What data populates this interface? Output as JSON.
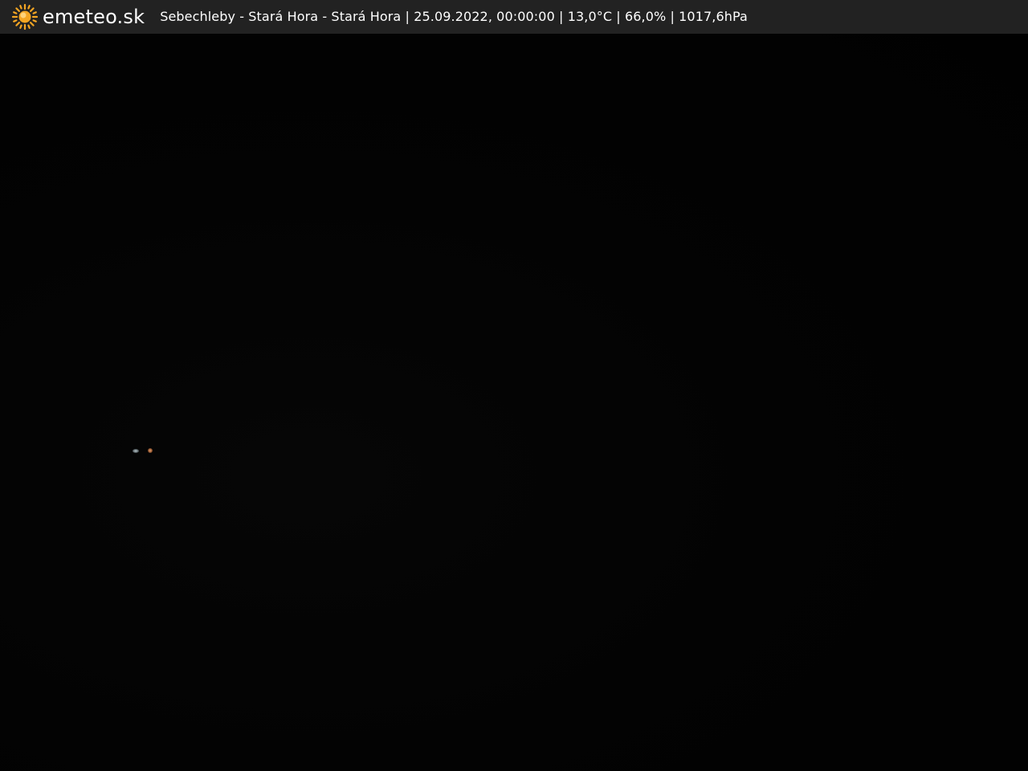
{
  "header": {
    "logo_icon": "sun-icon",
    "brand": "emeteo.sk",
    "caption": "Sebechleby - Stará Hora - Stará Hora | 25.09.2022, 00:00:00 | 13,0°C | 66,0% | 1017,6hPa"
  },
  "colors": {
    "bar_background": "#222222",
    "text": "#ffffff",
    "sun": "#f5a623",
    "scene": "#020202"
  }
}
